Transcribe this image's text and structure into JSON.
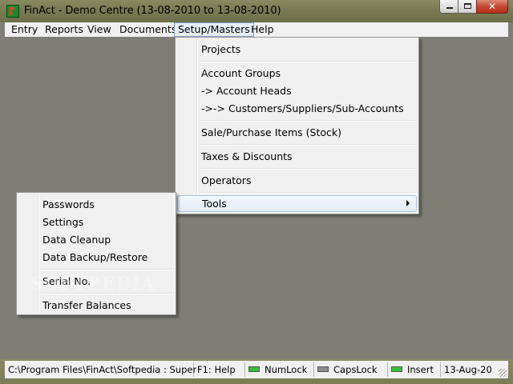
{
  "window": {
    "title": "FinAct - Demo Centre (13-08-2010 to 13-08-2010)",
    "controls": {
      "minimize": "",
      "maximize": "",
      "close": "✕"
    }
  },
  "menubar": {
    "items": [
      {
        "label": "Entry"
      },
      {
        "label": "Reports"
      },
      {
        "label": "View"
      },
      {
        "label": "Documents"
      },
      {
        "label": "Setup/Masters",
        "active": true
      },
      {
        "label": "Help"
      }
    ]
  },
  "setup_menu": {
    "items": [
      {
        "label": "Projects"
      },
      {
        "label": "Account Groups"
      },
      {
        "label": "-> Account Heads"
      },
      {
        "label": "->-> Customers/Suppliers/Sub-Accounts"
      },
      {
        "label": "Sale/Purchase Items (Stock)"
      },
      {
        "label": "Taxes & Discounts"
      },
      {
        "label": "Operators"
      },
      {
        "label": "Tools",
        "has_submenu": true,
        "highlighted": true
      }
    ]
  },
  "tools_submenu": {
    "items": [
      {
        "label": "Passwords"
      },
      {
        "label": "Settings"
      },
      {
        "label": "Data Cleanup"
      },
      {
        "label": "Data Backup/Restore"
      },
      {
        "label": "Serial No."
      },
      {
        "label": "Transfer Balances"
      }
    ]
  },
  "watermark": "SOFTPEDIA",
  "statusbar": {
    "path": "C:\\Program Files\\FinAct\\Softpedia : Super",
    "help": "F1: Help",
    "numlock": {
      "label": "NumLock",
      "state": "on"
    },
    "capslock": {
      "label": "CapsLock",
      "state": "off"
    },
    "insert": {
      "label": "Insert",
      "state": "on"
    },
    "date": "13-Aug-20"
  },
  "colors": {
    "desktop": "#7f7e76",
    "menu_bg": "#f0f0f0",
    "led_on": "#33c43a",
    "led_off": "#8c8c8c"
  }
}
